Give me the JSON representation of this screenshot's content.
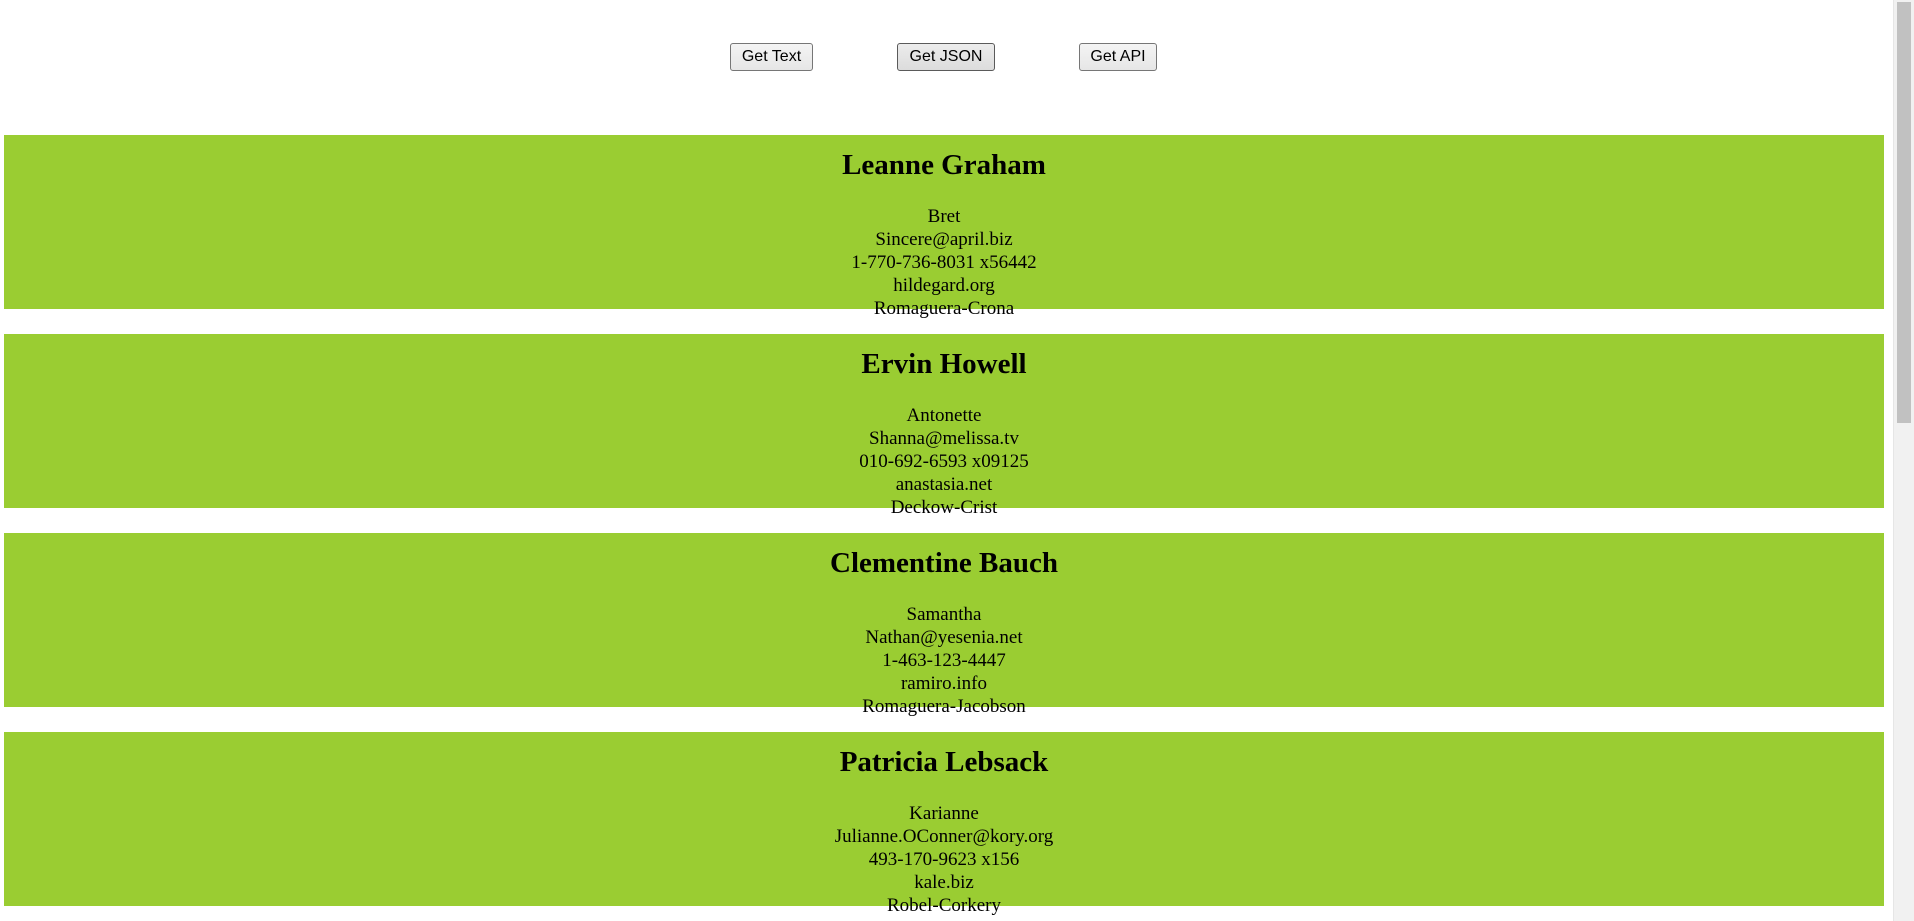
{
  "toolbar": {
    "get_text_label": "Get Text",
    "get_json_label": "Get JSON",
    "get_api_label": "Get API"
  },
  "users": [
    {
      "name": "Leanne Graham",
      "username": "Bret",
      "email": "Sincere@april.biz",
      "phone": "1-770-736-8031 x56442",
      "website": "hildegard.org",
      "company": "Romaguera-Crona"
    },
    {
      "name": "Ervin Howell",
      "username": "Antonette",
      "email": "Shanna@melissa.tv",
      "phone": "010-692-6593 x09125",
      "website": "anastasia.net",
      "company": "Deckow-Crist"
    },
    {
      "name": "Clementine Bauch",
      "username": "Samantha",
      "email": "Nathan@yesenia.net",
      "phone": "1-463-123-4447",
      "website": "ramiro.info",
      "company": "Romaguera-Jacobson"
    },
    {
      "name": "Patricia Lebsack",
      "username": "Karianne",
      "email": "Julianne.OConner@kory.org",
      "phone": "493-170-9623 x156",
      "website": "kale.biz",
      "company": "Robel-Corkery"
    }
  ],
  "colors": {
    "card_background": "#9acd32"
  }
}
